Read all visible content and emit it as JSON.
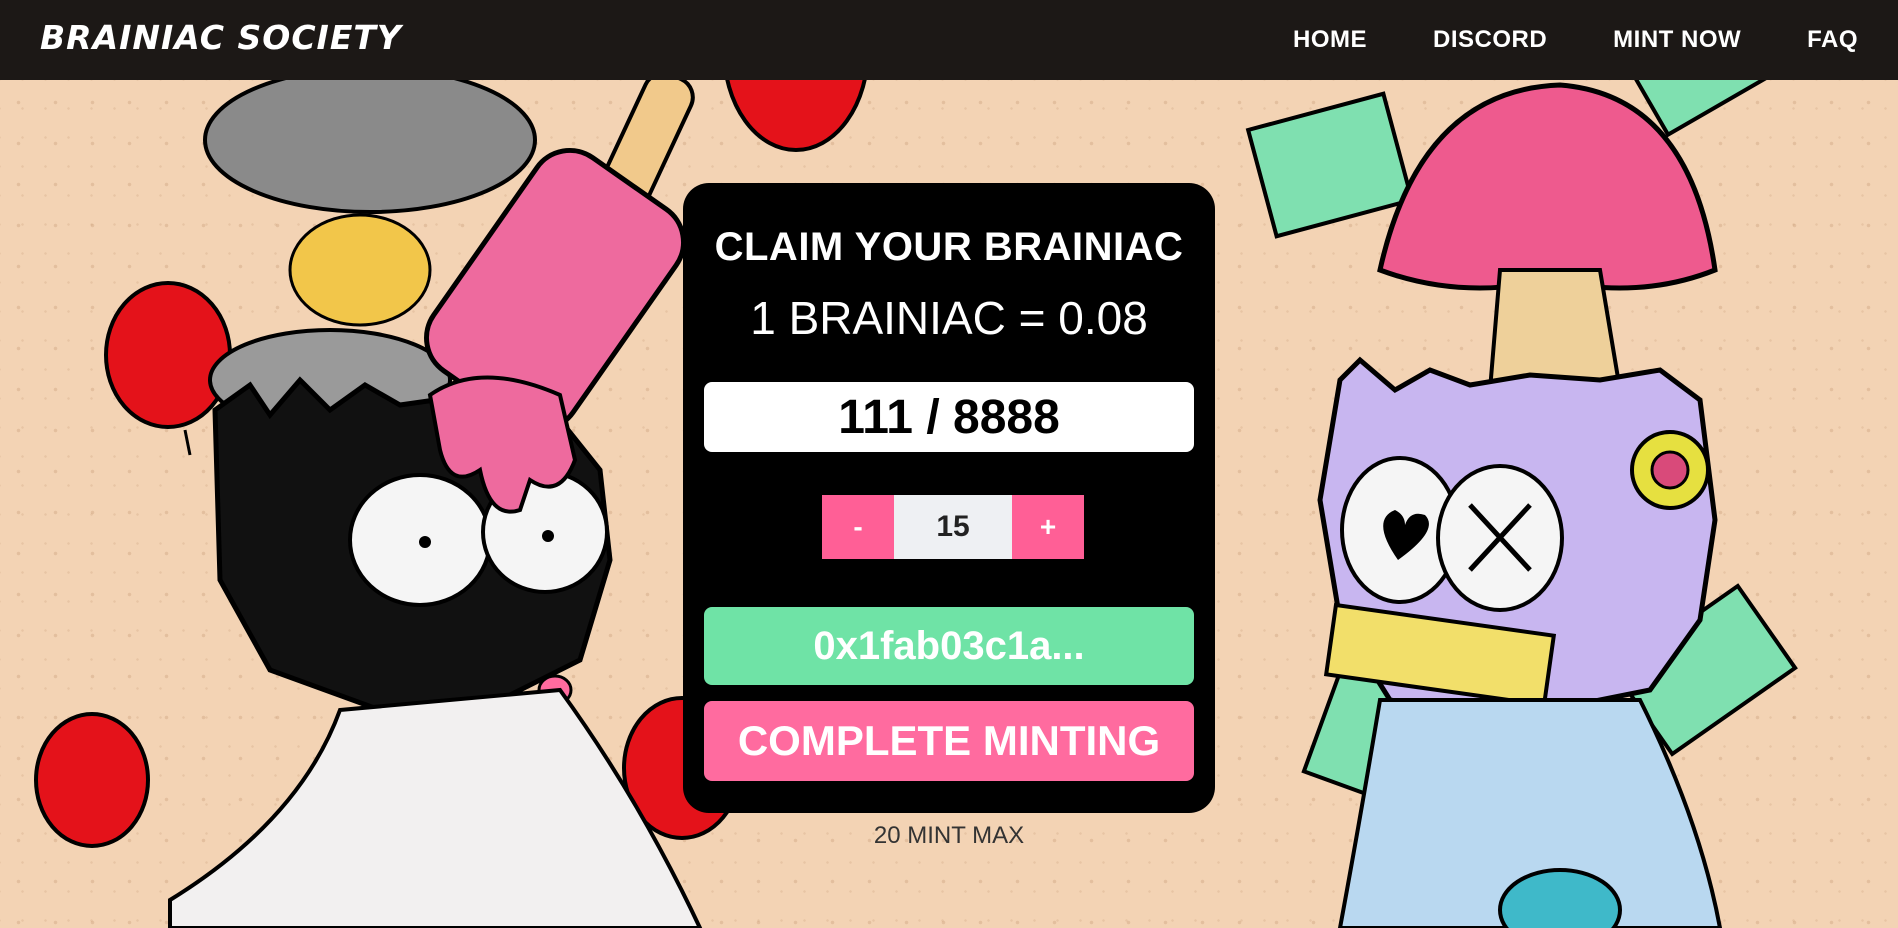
{
  "nav": {
    "brand": "BRAINIAC SOCIETY",
    "links": [
      "HOME",
      "DISCORD",
      "MINT NOW",
      "FAQ"
    ]
  },
  "mint": {
    "title": "CLAIM YOUR BRAINIAC",
    "price": "1 BRAINIAC = 0.08",
    "supply": "111 / 8888",
    "minus": "-",
    "plus": "+",
    "quantity": "15",
    "wallet": "0x1fab03c1a...",
    "complete": "COMPLETE MINTING",
    "max": "20 MINT MAX"
  },
  "colors": {
    "background": "#f3d3b4",
    "navbar": "#1c1816",
    "card": "#000000",
    "pink_accent": "#ff6b9f",
    "green_wallet": "#6fe3a6"
  }
}
